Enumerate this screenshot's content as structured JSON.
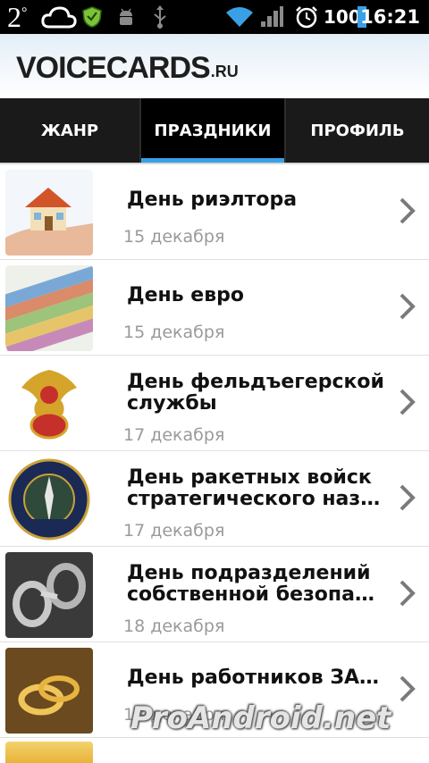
{
  "status_bar": {
    "temperature": "2",
    "temperature_unit": "°",
    "battery": "100",
    "time": "16:21"
  },
  "header": {
    "logo_main": "VOICECARDS",
    "logo_suffix": ".RU"
  },
  "tabs": [
    {
      "label": "ЖАНР",
      "active": false
    },
    {
      "label": "ПРАЗДНИКИ",
      "active": true
    },
    {
      "label": "ПРОФИЛЬ",
      "active": false
    }
  ],
  "colors": {
    "tab_indicator": "#3aa0e6",
    "date_text": "#9a9a9a",
    "title_text": "#111111"
  },
  "holidays": [
    {
      "title_line1": "День риэлтора",
      "title_line2": "",
      "date": "15 декабря",
      "thumb": "house-on-hand"
    },
    {
      "title_line1": "День евро",
      "title_line2": "",
      "date": "15 декабря",
      "thumb": "euro-banknotes"
    },
    {
      "title_line1": "День фельдъегерской",
      "title_line2": "службы",
      "date": "17 декабря",
      "thumb": "courier-service-emblem"
    },
    {
      "title_line1": "День ракетных войск",
      "title_line2": "стратегического назн...",
      "date": "17 декабря",
      "thumb": "strategic-missile-forces-emblem"
    },
    {
      "title_line1": "День подразделений",
      "title_line2": "собственной безопас...",
      "date": "18 декабря",
      "thumb": "handcuffs"
    },
    {
      "title_line1": "День работников ЗАГС",
      "title_line2": "",
      "date": "18 декабря",
      "thumb": "wedding-rings"
    }
  ],
  "watermark": "ProAndroid.net"
}
